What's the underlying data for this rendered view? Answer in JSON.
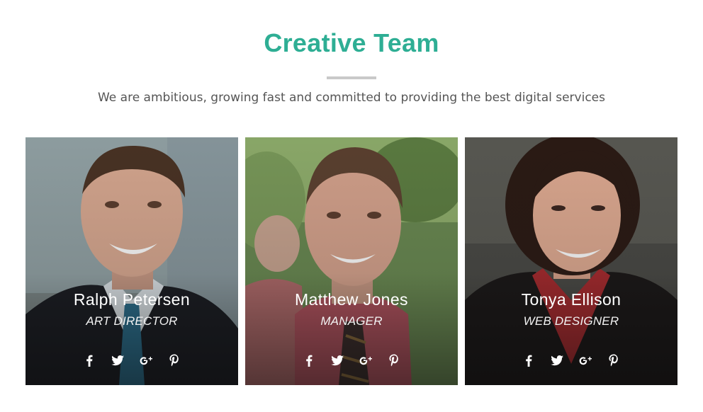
{
  "section": {
    "title": "Creative Team",
    "subtitle": "We are ambitious, growing fast and committed to providing the best digital services"
  },
  "team": [
    {
      "name": "Ralph Petersen",
      "role": "ART DIRECTOR",
      "photo": "man-smiling-suit-blue-tie"
    },
    {
      "name": "Matthew Jones",
      "role": "MANAGER",
      "photo": "man-smiling-pink-shirt-striped-tie"
    },
    {
      "name": "Tonya Ellison",
      "role": "WEB DESIGNER",
      "photo": "woman-smiling-red-blouse"
    }
  ],
  "social_icons": [
    "facebook-icon",
    "twitter-icon",
    "google-plus-icon",
    "pinterest-icon"
  ],
  "colors": {
    "accent": "#2eae94",
    "divider": "#c9c9c9",
    "subtitle": "#555555",
    "card_text": "#ffffff"
  }
}
